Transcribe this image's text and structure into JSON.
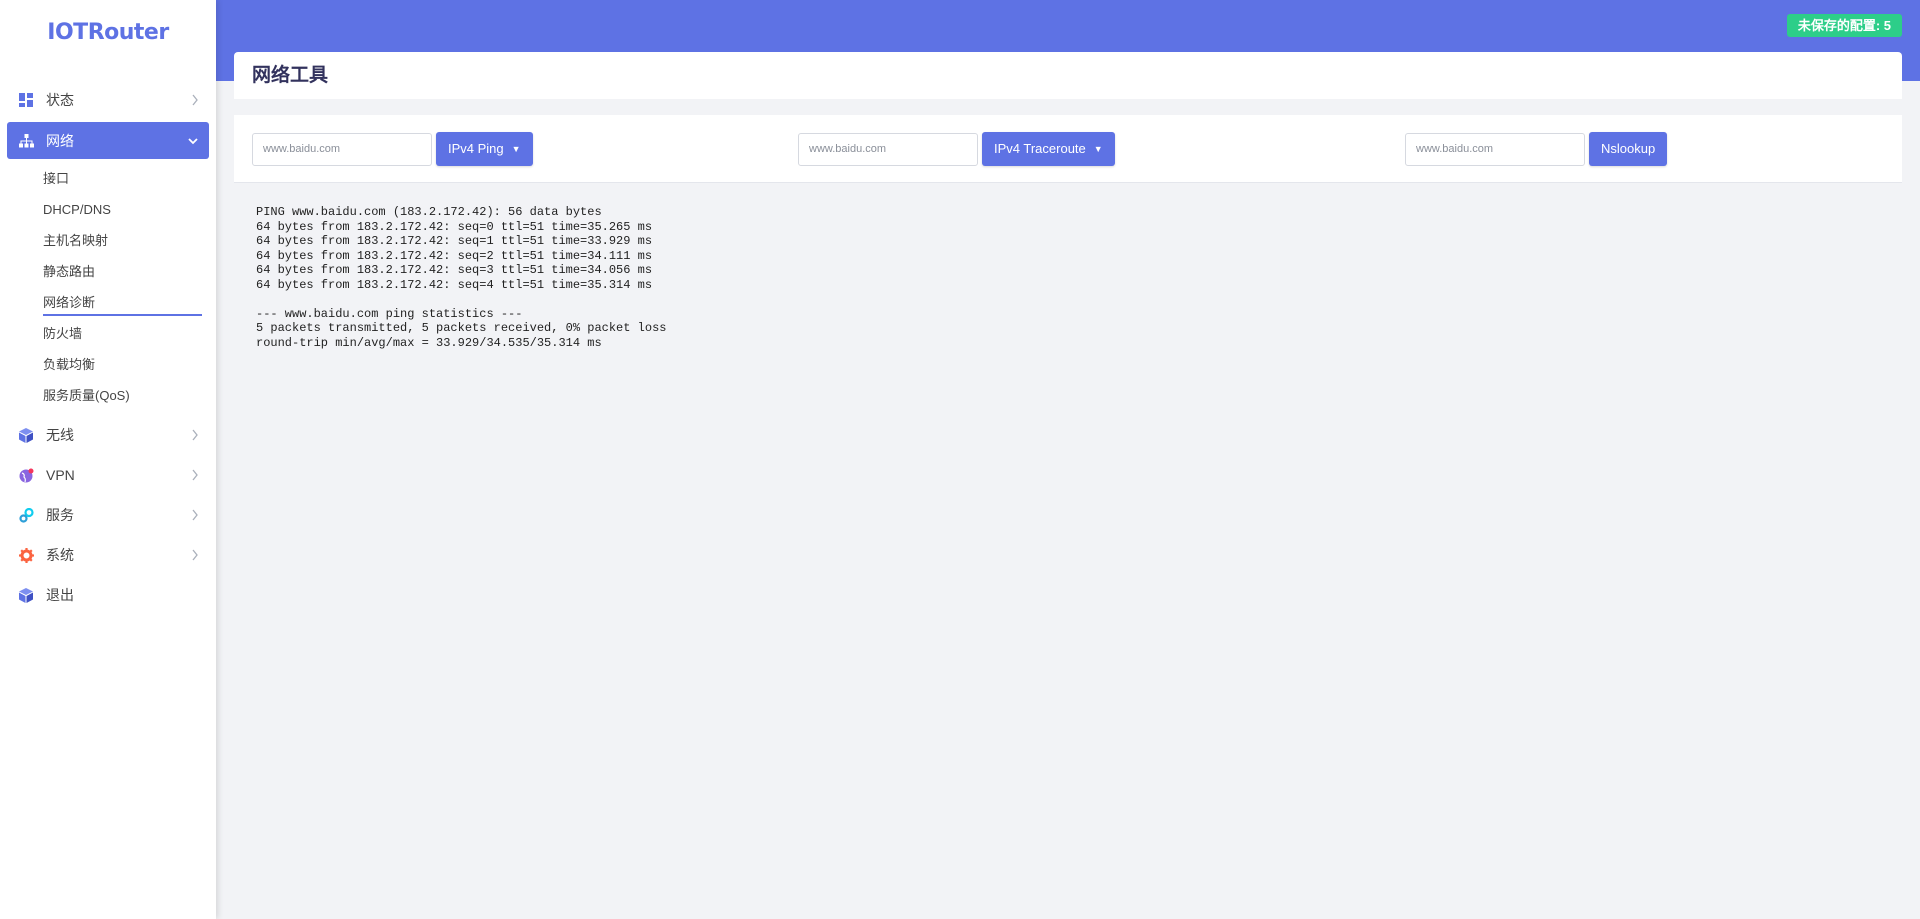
{
  "app": {
    "logo": "IOTRouter",
    "unsaved_badge": "未保存的配置: 5",
    "accent_color": "#5e72e4",
    "badge_color": "#2dce89"
  },
  "sidebar": {
    "items": [
      {
        "label": "状态",
        "icon": "dashboard-icon"
      },
      {
        "label": "网络",
        "icon": "network-icon"
      },
      {
        "label": "无线",
        "icon": "cube-icon"
      },
      {
        "label": "VPN",
        "icon": "globe-icon"
      },
      {
        "label": "服务",
        "icon": "gears-icon"
      },
      {
        "label": "系统",
        "icon": "gear-icon"
      },
      {
        "label": "退出",
        "icon": "logout-cube-icon"
      }
    ],
    "network_submenu": [
      {
        "label": "接口"
      },
      {
        "label": "DHCP/DNS"
      },
      {
        "label": "主机名映射"
      },
      {
        "label": "静态路由"
      },
      {
        "label": "网络诊断"
      },
      {
        "label": "防火墙"
      },
      {
        "label": "负载均衡"
      },
      {
        "label": "服务质量(QoS)"
      }
    ]
  },
  "page": {
    "title": "网络工具"
  },
  "tools": {
    "ping": {
      "input_value": "www.baidu.com",
      "button_label": "IPv4 Ping"
    },
    "traceroute": {
      "input_value": "www.baidu.com",
      "button_label": "IPv4 Traceroute"
    },
    "nslookup": {
      "input_value": "www.baidu.com",
      "button_label": "Nslookup"
    }
  },
  "output": {
    "text": "PING www.baidu.com (183.2.172.42): 56 data bytes\n64 bytes from 183.2.172.42: seq=0 ttl=51 time=35.265 ms\n64 bytes from 183.2.172.42: seq=1 ttl=51 time=33.929 ms\n64 bytes from 183.2.172.42: seq=2 ttl=51 time=34.111 ms\n64 bytes from 183.2.172.42: seq=3 ttl=51 time=34.056 ms\n64 bytes from 183.2.172.42: seq=4 ttl=51 time=35.314 ms\n\n--- www.baidu.com ping statistics ---\n5 packets transmitted, 5 packets received, 0% packet loss\nround-trip min/avg/max = 33.929/34.535/35.314 ms"
  }
}
